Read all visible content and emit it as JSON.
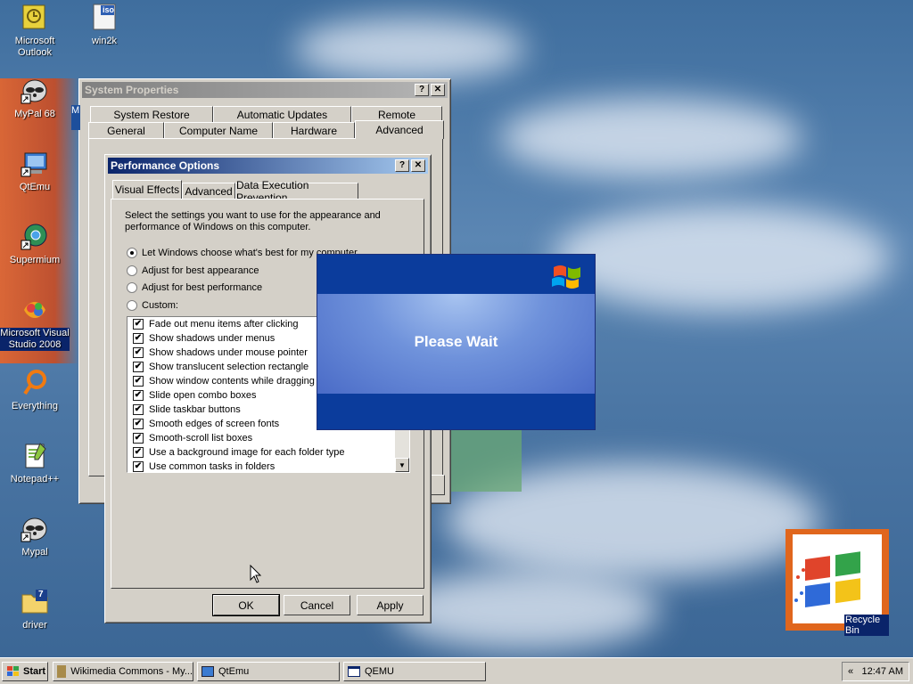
{
  "desktop": {
    "icons": [
      {
        "label": "Microsoft Outlook",
        "icon": "outlook-icon"
      },
      {
        "label": "win2k",
        "icon": "iso-file-icon",
        "badge": "iso"
      },
      {
        "label": "MyPal 68",
        "icon": "raccoon-shortcut-icon"
      },
      {
        "label": "QtEmu",
        "icon": "computer-shortcut-icon"
      },
      {
        "label": "Supermium",
        "icon": "globe-shortcut-icon"
      },
      {
        "label": "Microsoft Visual Studio 2008",
        "icon": "visual-studio-icon"
      },
      {
        "label": "Everything",
        "icon": "search-ring-icon"
      },
      {
        "label": "Notepad++",
        "icon": "notepad-icon"
      },
      {
        "label": "Mypal",
        "icon": "raccoon-shortcut-icon"
      },
      {
        "label": "driver",
        "icon": "folder-icon",
        "badge": "7"
      },
      {
        "label": "Recycle Bin",
        "icon": "windows-flag-icon"
      }
    ]
  },
  "system_properties": {
    "title": "System Properties",
    "tabs_row1": [
      "System Restore",
      "Automatic Updates",
      "Remote"
    ],
    "tabs_row2": [
      "General",
      "Computer Name",
      "Hardware",
      "Advanced"
    ],
    "selected_tab": "Advanced",
    "hidden_letter": "M"
  },
  "performance_options": {
    "title": "Performance Options",
    "tabs": [
      "Visual Effects",
      "Advanced",
      "Data Execution Prevention"
    ],
    "selected_tab": "Visual Effects",
    "instruction": "Select the settings you want to use for the appearance and performance of Windows on this computer.",
    "radios": [
      {
        "label": "Let Windows choose what's best for my computer",
        "checked": true
      },
      {
        "label": "Adjust for best appearance",
        "checked": false
      },
      {
        "label": "Adjust for best performance",
        "checked": false
      },
      {
        "label": "Custom:",
        "checked": false
      }
    ],
    "effects": [
      "Fade out menu items after clicking",
      "Show shadows under menus",
      "Show shadows under mouse pointer",
      "Show translucent selection rectangle",
      "Show window contents while dragging",
      "Slide open combo boxes",
      "Slide taskbar buttons",
      "Smooth edges of screen fonts",
      "Smooth-scroll list boxes",
      "Use a background image for each folder type",
      "Use common tasks in folders"
    ],
    "check_mark": "✔",
    "buttons": {
      "ok": "OK",
      "cancel": "Cancel",
      "apply": "Apply"
    }
  },
  "splash": {
    "message": "Please Wait"
  },
  "taskbar": {
    "start": "Start",
    "items": [
      "Wikimedia Commons - My...",
      "QtEmu",
      "QEMU"
    ],
    "tray_arrow": "«",
    "clock": "12:47 AM"
  },
  "colors": {
    "accent": "#0a246a",
    "face": "#d4d0c8",
    "splash_blue": "#0b3c9c"
  }
}
